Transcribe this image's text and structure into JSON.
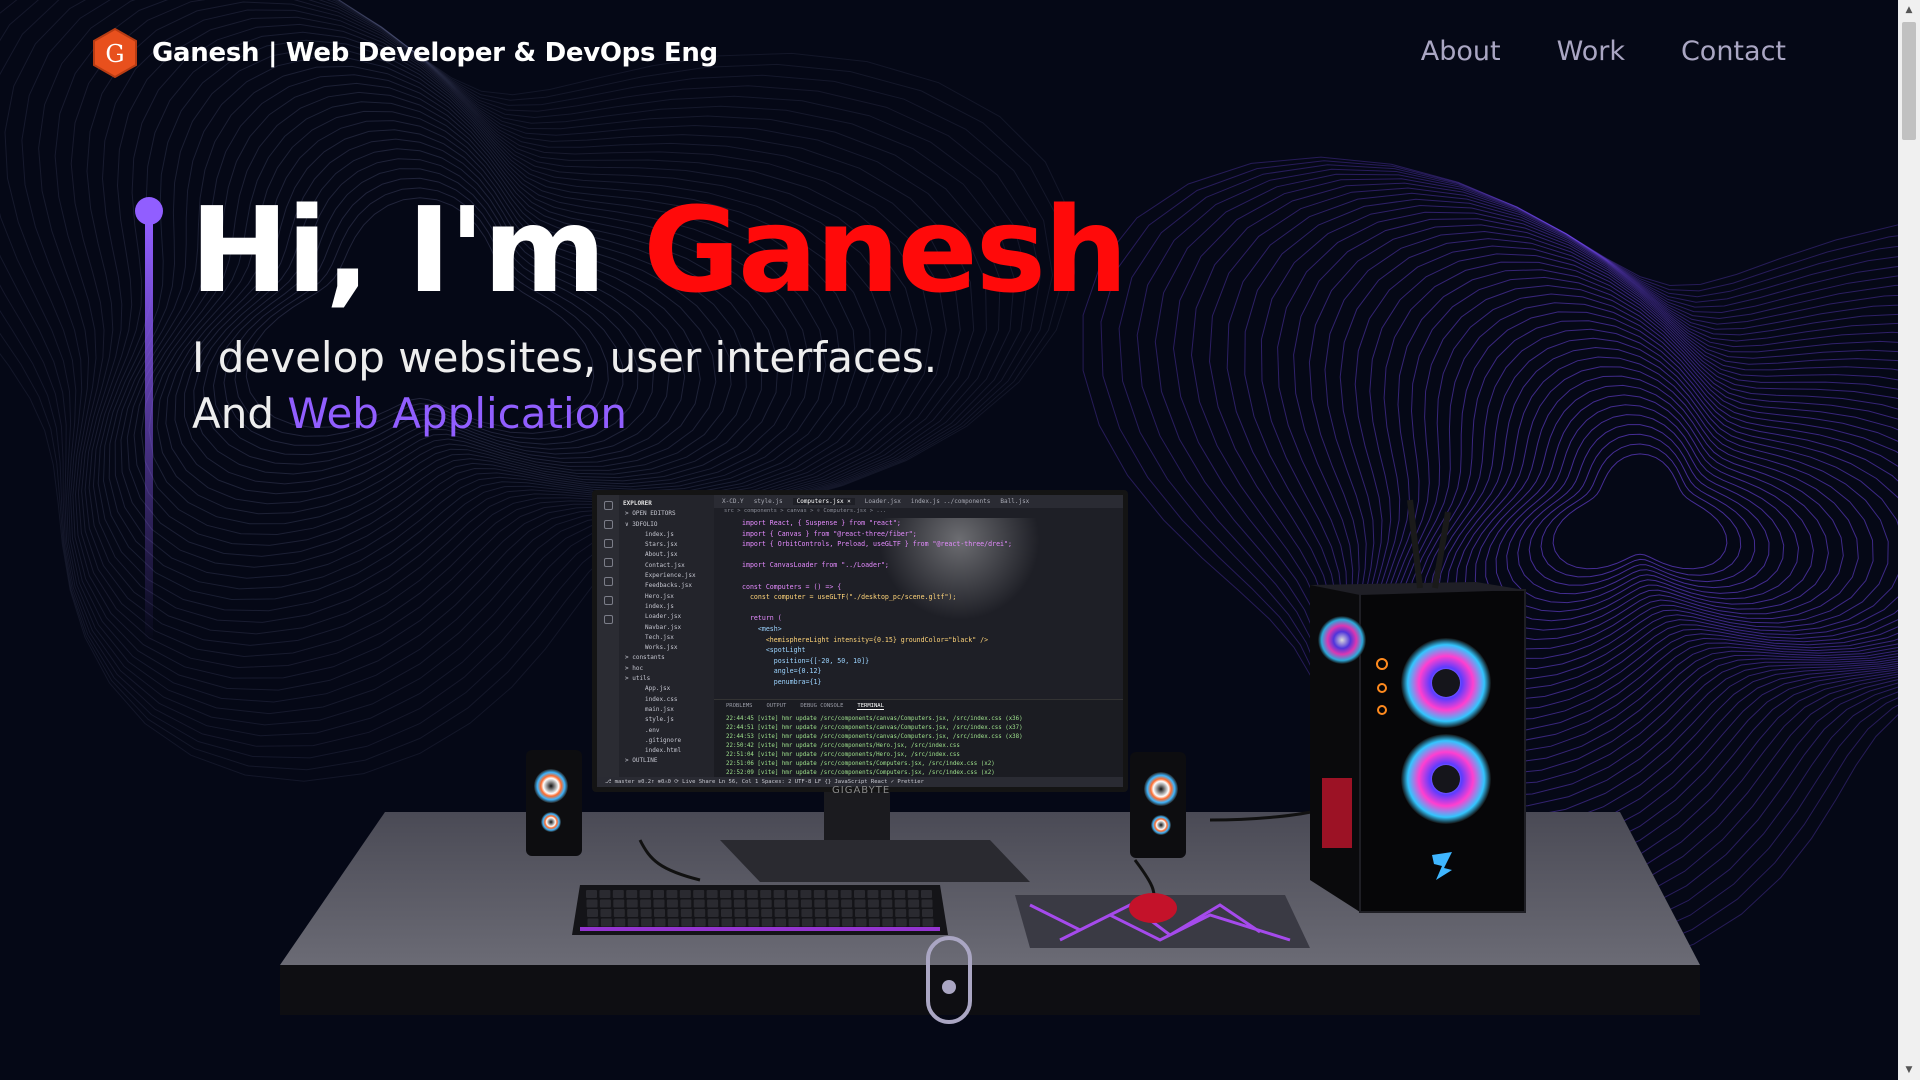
{
  "navbar": {
    "logo_letter": "G",
    "brand": "Ganesh | Web Developer & DevOps Eng",
    "links": [
      "About",
      "Work",
      "Contact"
    ]
  },
  "hero": {
    "greeting": "Hi, I'm ",
    "name": "Ganesh",
    "line1": "I develop websites, user interfaces.",
    "line2_prefix": "And ",
    "line2_accent": "Web Application"
  },
  "monitor": {
    "brand_label": "GIGABYTE",
    "tabs": [
      "X-CD.Y",
      "style.js",
      "Computers.jsx ×",
      "Loader.jsx",
      "index.js  ../components",
      "Ball.jsx"
    ],
    "breadcrumb": "src > components > canvas > ⚛ Computers.jsx > ...",
    "explorer_title": "EXPLORER",
    "explorer_items": [
      "> OPEN EDITORS",
      "∨ 3DFOLIO",
      "index.js",
      "Stars.jsx",
      "About.jsx",
      "Contact.jsx",
      "Experience.jsx",
      "Feedbacks.jsx",
      "Hero.jsx",
      "index.js",
      "Loader.jsx",
      "Navbar.jsx",
      "Tech.jsx",
      "Works.jsx",
      "> constants",
      "> hoc",
      "> utils",
      "App.jsx",
      "index.css",
      "main.jsx",
      "style.js",
      ".env",
      ".gitignore",
      "index.html",
      "> OUTLINE"
    ],
    "code_lines": [
      "import React, { Suspense } from \"react\";",
      "import { Canvas } from \"@react-three/fiber\";",
      "import { OrbitControls, Preload, useGLTF } from \"@react-three/drei\";",
      "",
      "import CanvasLoader from \"../Loader\";",
      "",
      "const Computers = () => {",
      "  const computer = useGLTF(\"./desktop_pc/scene.gltf\");",
      "",
      "  return (",
      "    <mesh>",
      "      <hemisphereLight intensity={0.15} groundColor=\"black\" />",
      "      <spotLight",
      "        position={[-20, 50, 10]}",
      "        angle={0.12}",
      "        penumbra={1}"
    ],
    "panel_tabs": [
      "PROBLEMS",
      "OUTPUT",
      "DEBUG CONSOLE",
      "TERMINAL"
    ],
    "terminal_lines": [
      "22:44:45 [vite] hmr update /src/components/canvas/Computers.jsx, /src/index.css (x36)",
      "22:44:51 [vite] hmr update /src/components/canvas/Computers.jsx, /src/index.css (x37)",
      "22:44:53 [vite] hmr update /src/components/canvas/Computers.jsx, /src/index.css (x38)",
      "22:50:42 [vite] hmr update /src/components/Hero.jsx, /src/index.css",
      "22:51:04 [vite] hmr update /src/components/Hero.jsx, /src/index.css",
      "22:51:06 [vite] hmr update /src/components/Computers.jsx, /src/index.css (x2)",
      "22:52:09 [vite] hmr update /src/components/Computers.jsx, /src/index.css (x2)"
    ],
    "status_bar": "⎇ master  ⊙0.2↑  ⊗0⚠0  ⟳ Live Share        Ln 56, Col 1  Spaces: 2  UTF-8  LF  {} JavaScript React  ✓ Prettier"
  },
  "colors": {
    "background": "#050816",
    "accent_purple": "#915eff",
    "name_red": "#ff0a0a",
    "nav_text": "#aaa6c3",
    "logo_orange": "#e8501d"
  }
}
